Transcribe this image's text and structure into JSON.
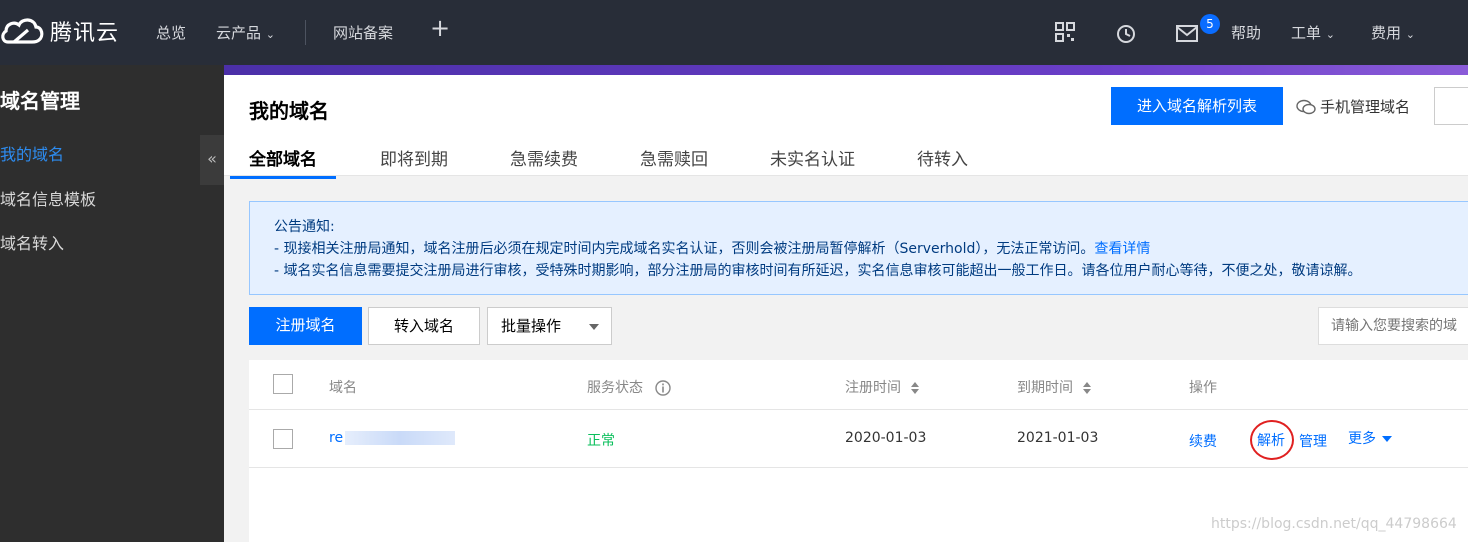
{
  "topbar": {
    "brand": "腾讯云",
    "nav": [
      "总览",
      "云产品",
      "网站备案"
    ],
    "badge_count": "5",
    "help": "帮助",
    "ticket": "工单",
    "billing": "费用"
  },
  "sidebar": {
    "title": "域名管理",
    "items": [
      {
        "label": "我的域名",
        "active": true
      },
      {
        "label": "域名信息模板",
        "active": false
      },
      {
        "label": "域名转入",
        "active": false
      }
    ],
    "collapse_glyph": "«"
  },
  "header": {
    "title": "我的域名",
    "primary_button": "进入域名解析列表",
    "mobile_link": "手机管理域名",
    "tabs": [
      "全部域名",
      "即将到期",
      "急需续费",
      "急需赎回",
      "未实名认证",
      "待转入"
    ]
  },
  "notice": {
    "heading": "公告通知:",
    "line1": "- 现接相关注册局通知，域名注册后必须在规定时间内完成域名实名认证，否则会被注册局暂停解析（Serverhold），无法正常访问。",
    "line1_link": "查看详情",
    "line2": "- 域名实名信息需要提交注册局进行审核，受特殊时期影响，部分注册局的审核时间有所延迟，实名信息审核可能超出一般工作日。请各位用户耐心等待，不便之处，敬请谅解。"
  },
  "toolbar": {
    "register": "注册域名",
    "transfer": "转入域名",
    "batch": "批量操作",
    "search_placeholder": "请输入您要搜索的域"
  },
  "table": {
    "headers": {
      "domain": "域名",
      "status": "服务状态",
      "reg_time": "注册时间",
      "exp_time": "到期时间",
      "ops": "操作"
    },
    "rows": [
      {
        "domain": "re",
        "status": "正常",
        "reg_time": "2020-01-03",
        "exp_time": "2021-01-03",
        "ops": [
          "续费",
          "解析",
          "管理",
          "更多"
        ]
      }
    ]
  },
  "watermark": "https://blog.csdn.net/qq_44798664",
  "colors": {
    "accent": "#006eff",
    "topbar": "#282d38",
    "sidebar": "#2e2e2e",
    "status_ok": "#0abf5b",
    "highlight": "#e02020"
  }
}
